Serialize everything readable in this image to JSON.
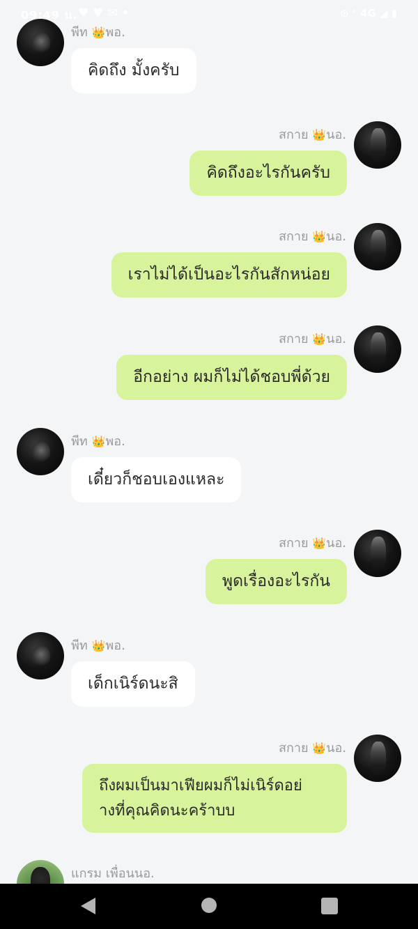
{
  "status_bar": {
    "time": "09:49 น.",
    "left_icons": "♥ ♥ ✉ •",
    "right_icons": "⊙ ᐩ 4G ◢ ▮"
  },
  "crown": "👑",
  "messages": [
    {
      "side": "left",
      "name": "พีท",
      "suffix": "พอ.",
      "text": "คิดถึง มั้งครับ"
    },
    {
      "side": "right",
      "name": "สกาย",
      "suffix": "นอ.",
      "text": "คิดถึงอะไรกันครับ"
    },
    {
      "side": "right",
      "name": "สกาย",
      "suffix": "นอ.",
      "text": "เราไม่ได้เป็นอะไรกันสักหน่อย"
    },
    {
      "side": "right",
      "name": "สกาย",
      "suffix": "นอ.",
      "text": "อีกอย่าง ผมก็ไม่ได้ชอบพี่ด้วย"
    },
    {
      "side": "left",
      "name": "พีท",
      "suffix": "พอ.",
      "text": "เดี๋ยวก็ชอบเองแหละ"
    },
    {
      "side": "right",
      "name": "สกาย",
      "suffix": "นอ.",
      "text": "พูดเรื่องอะไรกัน"
    },
    {
      "side": "left",
      "name": "พีท",
      "suffix": "พอ.",
      "text": "เด็กเนิร์ดนะสิ"
    },
    {
      "side": "right",
      "name": "สกาย",
      "suffix": "นอ.",
      "text": "ถึงผมเป็นมาเฟียผมก็ไม่เนิร์ดอย่\nางที่คุณคิดนะคร้าบบ"
    },
    {
      "side": "left",
      "name": "แกรม เพื่อนนอ.",
      "suffix": "",
      "text": ""
    }
  ]
}
